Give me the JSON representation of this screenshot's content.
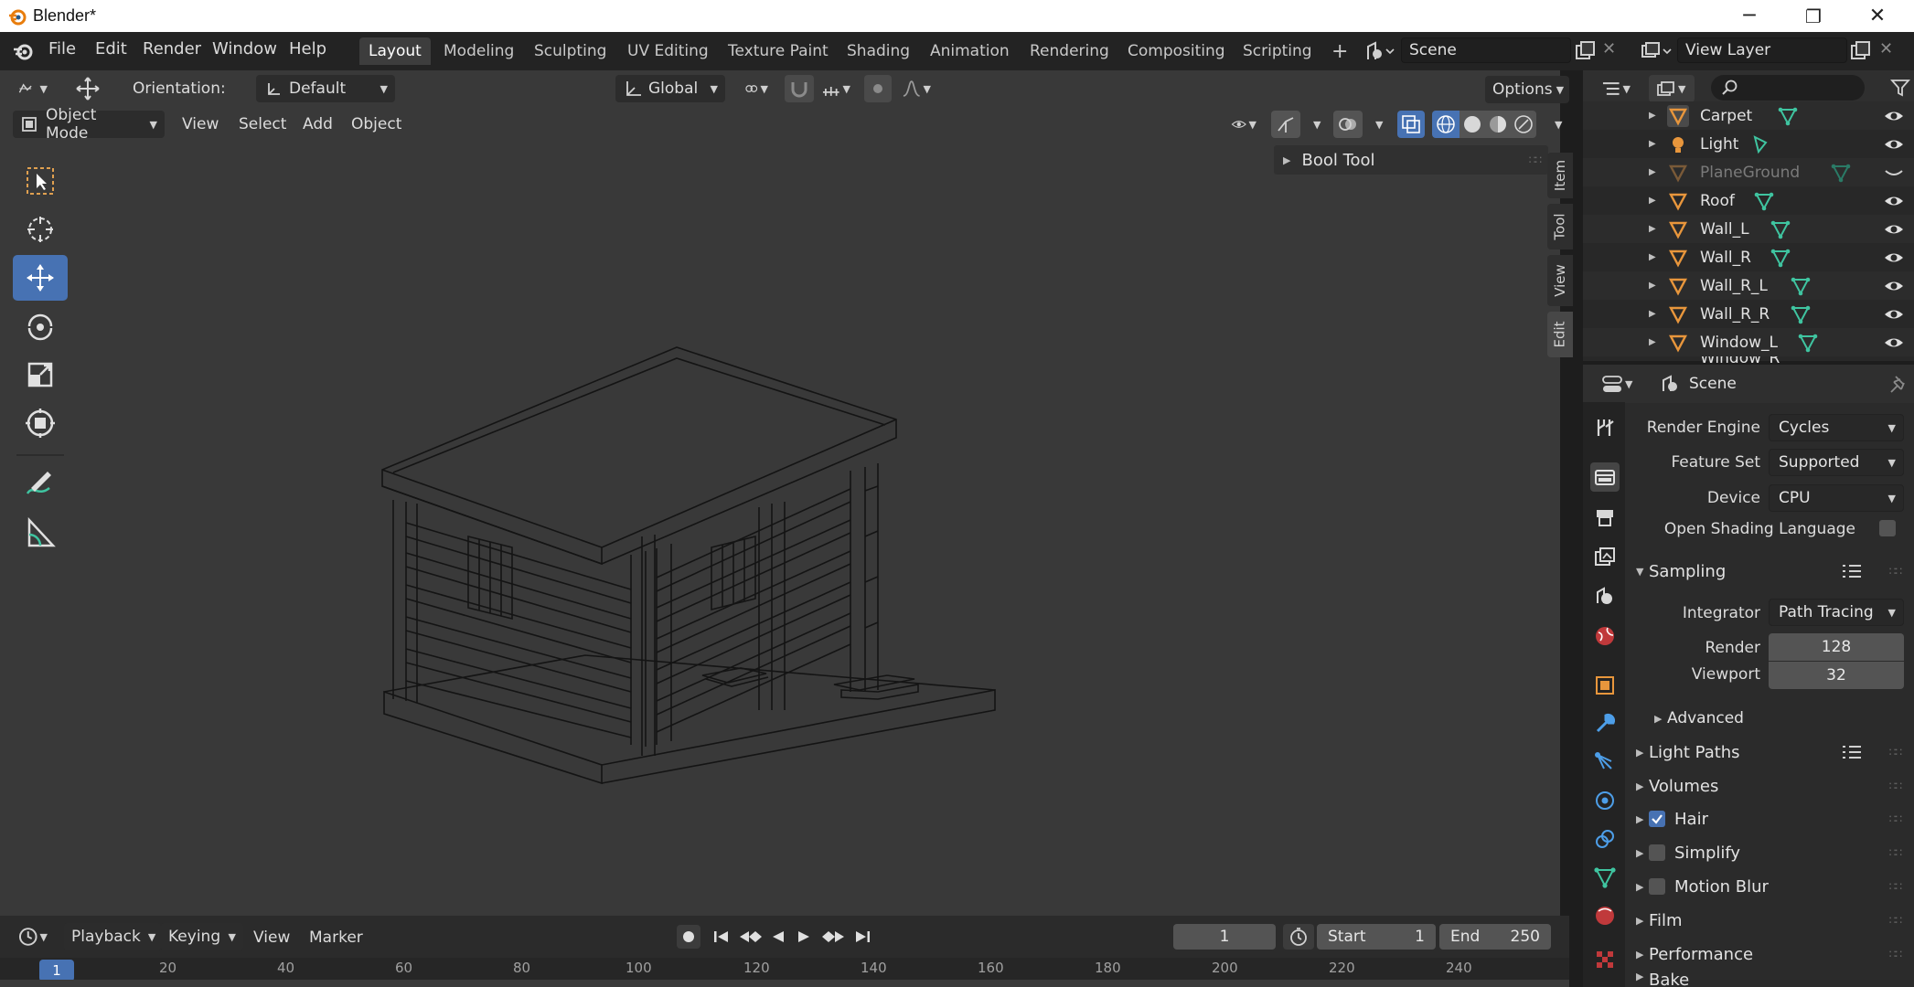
{
  "window": {
    "title": "Blender*",
    "minimize": "─",
    "maximize": "❐",
    "close": "✕"
  },
  "menu": {
    "file": "File",
    "edit": "Edit",
    "render": "Render",
    "window": "Window",
    "help": "Help"
  },
  "workspaces": [
    "Layout",
    "Modeling",
    "Sculpting",
    "UV Editing",
    "Texture Paint",
    "Shading",
    "Animation",
    "Rendering",
    "Compositing",
    "Scripting"
  ],
  "workspace_add": "+",
  "scene_field": "Scene",
  "view_layer_field": "View Layer",
  "viewport": {
    "orientation_label": "Orientation:",
    "orientation_value": "Default",
    "transform_orientation": "Global",
    "options": "Options",
    "mode": "Object Mode",
    "view": "View",
    "select": "Select",
    "add": "Add",
    "object": "Object",
    "bool_tool": "Bool Tool",
    "side_tabs": [
      "Item",
      "Tool",
      "View",
      "Edit"
    ]
  },
  "timeline": {
    "playback": "Playback",
    "keying": "Keying",
    "view": "View",
    "marker": "Marker",
    "current_frame": "1",
    "start_label": "Start",
    "start_value": "1",
    "end_label": "End",
    "end_value": "250",
    "ruler": [
      "1",
      "20",
      "40",
      "60",
      "80",
      "100",
      "120",
      "140",
      "160",
      "180",
      "200",
      "220",
      "240"
    ]
  },
  "outliner": {
    "items": [
      {
        "name": "Carpet",
        "visible": true
      },
      {
        "name": "Light",
        "visible": true
      },
      {
        "name": "PlaneGround",
        "visible": false
      },
      {
        "name": "Roof",
        "visible": true
      },
      {
        "name": "Wall_L",
        "visible": true
      },
      {
        "name": "Wall_R",
        "visible": true
      },
      {
        "name": "Wall_R_L",
        "visible": true
      },
      {
        "name": "Wall_R_R",
        "visible": true
      },
      {
        "name": "Window_L",
        "visible": true
      },
      {
        "name": "Window_R",
        "visible": true
      }
    ]
  },
  "properties": {
    "context": "Scene",
    "render_engine_label": "Render Engine",
    "render_engine": "Cycles",
    "feature_set_label": "Feature Set",
    "feature_set": "Supported",
    "device_label": "Device",
    "device": "CPU",
    "osl_label": "Open Shading Language",
    "sampling": "Sampling",
    "integrator_label": "Integrator",
    "integrator": "Path Tracing",
    "render_label": "Render",
    "render_samples": "128",
    "viewport_label": "Viewport",
    "viewport_samples": "32",
    "advanced": "Advanced",
    "light_paths": "Light Paths",
    "volumes": "Volumes",
    "hair": "Hair",
    "simplify": "Simplify",
    "motion_blur": "Motion Blur",
    "film": "Film",
    "performance": "Performance",
    "bake": "Bake"
  },
  "colors": {
    "accent": "#4772b3",
    "object_orange": "#e8963c",
    "mesh_green": "#3fc4a0"
  }
}
